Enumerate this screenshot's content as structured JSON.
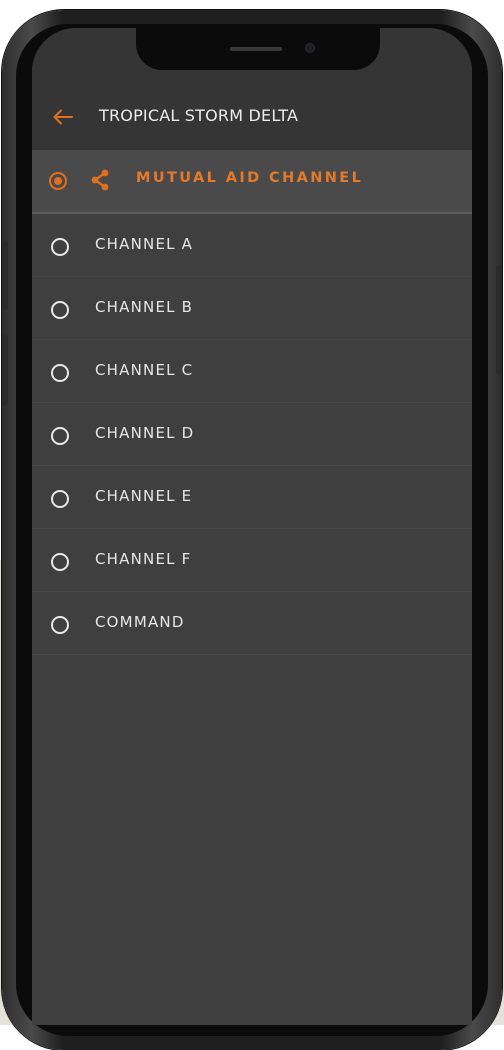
{
  "header": {
    "title": "TROPICAL STORM DELTA"
  },
  "selected_channel": {
    "label": "MUTUAL AID CHANNEL",
    "shared": true
  },
  "channels": [
    {
      "label": "CHANNEL A",
      "selected": false
    },
    {
      "label": "CHANNEL B",
      "selected": false
    },
    {
      "label": "CHANNEL C",
      "selected": false
    },
    {
      "label": "CHANNEL D",
      "selected": false
    },
    {
      "label": "CHANNEL E",
      "selected": false
    },
    {
      "label": "CHANNEL F",
      "selected": false
    },
    {
      "label": "COMMAND",
      "selected": false
    }
  ],
  "icons": {
    "back": "back-arrow-icon",
    "share": "share-icon",
    "radio_selected": "radio-selected-icon",
    "radio_unselected": "radio-unselected-icon"
  },
  "colors": {
    "accent": "#e0701e",
    "screen_background": "#3f3f3f",
    "app_bar": "#353535",
    "selected_bar": "#4a4a4a",
    "text": "#e6e6e6"
  }
}
